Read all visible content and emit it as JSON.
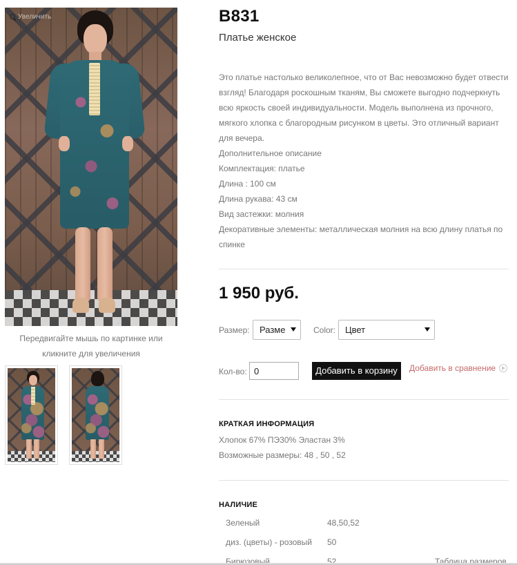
{
  "product": {
    "sku": "B831",
    "subtitle": "Платье женское",
    "zoom_hint": "Увеличить",
    "photo_caption": "Передвигайте мышь по картинке или кликните для увеличения",
    "description": [
      "Это платье настолько великолепное, что от Вас невозможно будет отвести взгляд! Благодаря роскошным тканям, Вы сможете выгодно подчеркнуть всю яркость своей индивидуальности. Модель выполнена из прочного, мягкого хлопка с благородным рисунком в цветы. Это отличный вариант для вечера.",
      "Дополнительное описание",
      "Комплектация: платье",
      "Длина : 100 см",
      "Длина рукава: 43 см",
      "Вид застежки: молния",
      "Декоративные элементы: металлическая молния на всю длину платья по спинке"
    ],
    "price": "1 950 руб."
  },
  "options": {
    "size_label": "Размер:",
    "size_value": "Размер",
    "color_label": "Color:",
    "color_value": "Цвет",
    "qty_label": "Кол-во:",
    "qty_value": "0",
    "add_to_cart": "Добавить в корзину",
    "add_to_compare": "Добавить в сравнение"
  },
  "brief": {
    "title": "КРАТКАЯ ИНФОРМАЦИЯ",
    "composition": "Хлопок 67% ПЭ30% Эластан 3%",
    "sizes": "Возможные размеры: 48 , 50 , 52"
  },
  "availability": {
    "title": "НАЛИЧИЕ",
    "rows": [
      {
        "name": "Зеленый",
        "sizes": "48,50,52"
      },
      {
        "name": "диз. (цветы) - розовый",
        "sizes": "50"
      },
      {
        "name": "Бирюзовый",
        "sizes": "52"
      }
    ],
    "size_table_link": "Таблица размеров"
  },
  "colors": {
    "dress": "#2e6a75",
    "button": "#111111",
    "compare_link": "#c46a6a"
  }
}
